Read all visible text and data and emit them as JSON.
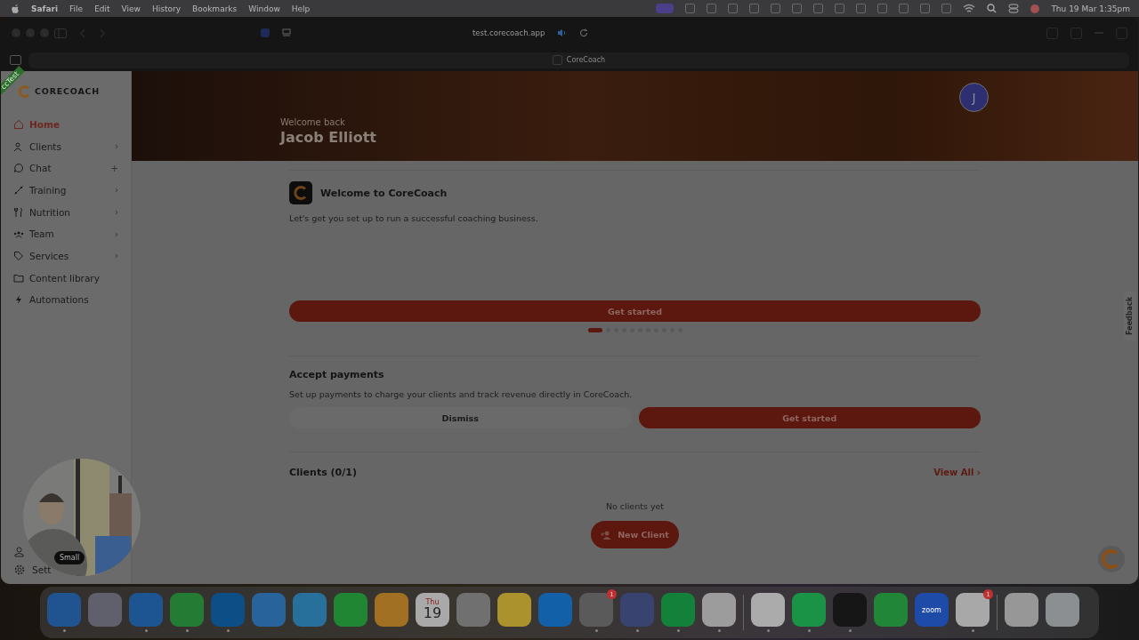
{
  "menu_bar": {
    "app": "Safari",
    "items": [
      "File",
      "Edit",
      "View",
      "History",
      "Bookmarks",
      "Window",
      "Help"
    ],
    "clock": "Thu 19 Mar  1:35pm"
  },
  "browser": {
    "url": "test.corecoach.app",
    "tab_title": "CoreCoach"
  },
  "sidebar": {
    "brand": "CORECOACH",
    "env_badge": "ccTest",
    "items": [
      {
        "label": "Home",
        "selected": true
      },
      {
        "label": "Clients",
        "selected": false,
        "trailing": "›"
      },
      {
        "label": "Chat",
        "selected": false,
        "trailing": "+"
      },
      {
        "label": "Training",
        "selected": false,
        "trailing": "›"
      },
      {
        "label": "Nutrition",
        "selected": false,
        "trailing": "›"
      },
      {
        "label": "Team",
        "selected": false,
        "trailing": "›"
      },
      {
        "label": "Services",
        "selected": false,
        "trailing": "›"
      },
      {
        "label": "Content library",
        "selected": false
      },
      {
        "label": "Automations",
        "selected": false
      }
    ],
    "settings_label": "Sett"
  },
  "header": {
    "greeting": "Welcome back",
    "name": "Jacob Elliott",
    "avatar": "J"
  },
  "welcome_card": {
    "title": "Welcome to CoreCoach",
    "text": "Let's get you set up to run a successful coaching business.",
    "button": "Get started",
    "dots": [
      {
        "selected": true
      },
      {
        "selected": false
      },
      {
        "selected": false
      },
      {
        "selected": false
      },
      {
        "selected": false
      },
      {
        "selected": false
      },
      {
        "selected": false
      },
      {
        "selected": false
      },
      {
        "selected": false
      },
      {
        "selected": false
      },
      {
        "selected": false
      }
    ]
  },
  "payments": {
    "title": "Accept payments",
    "text": "Set up payments to charge your clients and track revenue directly in CoreCoach.",
    "dismiss": "Dismiss",
    "button": "Get started"
  },
  "clients": {
    "title": "Clients (0/1)",
    "view_all": "View All ›",
    "empty": "No clients yet",
    "button": "New Client"
  },
  "feedback": "Feedback",
  "webcam": {
    "size_label": "Small"
  },
  "dock": [
    {
      "color": "#1f5490",
      "running": true
    },
    {
      "color": "#60606c",
      "running": false
    },
    {
      "color": "#1d5592",
      "running": true
    },
    {
      "color": "#237b34",
      "running": true
    },
    {
      "color": "#0e4e86",
      "running": true
    },
    {
      "color": "#28639c",
      "running": false
    },
    {
      "color": "#28709c",
      "running": false
    },
    {
      "color": "#208634",
      "running": false
    },
    {
      "color": "#a27022",
      "running": false
    },
    {
      "color": "#a9a9a9",
      "running": false,
      "label": "19",
      "sub": "Thu"
    },
    {
      "color": "#707070",
      "running": false
    },
    {
      "color": "#ab922c",
      "running": false
    },
    {
      "color": "#1260a8",
      "running": false
    },
    {
      "color": "#5a5a5a",
      "running": true,
      "badge": "1"
    },
    {
      "color": "#384370",
      "running": true
    },
    {
      "color": "#14813a",
      "running": true
    },
    {
      "color": "#9c9c9c",
      "running": true
    },
    {
      "color": "#ababab",
      "running": true
    },
    {
      "color": "#1a9347",
      "running": true
    },
    {
      "color": "#161616",
      "running": true
    },
    {
      "color": "#228638",
      "running": false
    },
    {
      "color": "#1f4ba8",
      "running": false,
      "label": "zoom"
    },
    {
      "color": "#a8a8a8",
      "running": true,
      "badge": "1"
    },
    {
      "color": "#979797",
      "running": false
    },
    {
      "color": "#8c8f91",
      "running": false
    }
  ]
}
